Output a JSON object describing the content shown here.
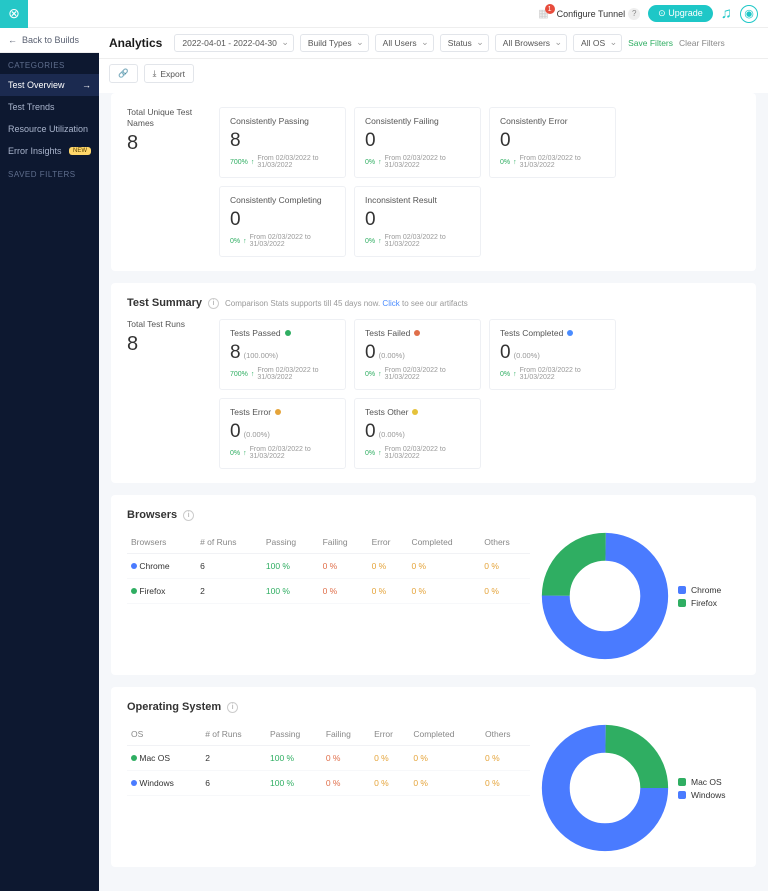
{
  "header": {
    "notif_badge": "1",
    "configure_tunnel": "Configure Tunnel",
    "upgrade": "⊙ Upgrade"
  },
  "sidebar": {
    "back": "Back to Builds",
    "h1": "CATEGORIES",
    "items": [
      "Test Overview",
      "Test Trends",
      "Resource Utilization",
      "Error Insights"
    ],
    "pill": "NEW",
    "h2": "SAVED FILTERS"
  },
  "filters": {
    "title": "Analytics",
    "date": "2022-04-01 - 2022-04-30",
    "f": [
      "Build Types",
      "All Users",
      "Status",
      "All Browsers",
      "All OS"
    ],
    "save": "Save Filters",
    "clear": "Clear Filters",
    "export": "Export"
  },
  "overview": {
    "left_t": "Total Unique Test Names",
    "left_n": "8",
    "tiles": [
      {
        "t": "Consistently Passing",
        "n": "8",
        "pct": "700%",
        "range": "From 02/03/2022 to 31/03/2022"
      },
      {
        "t": "Consistently Failing",
        "n": "0",
        "pct": "0%",
        "range": "From 02/03/2022 to 31/03/2022"
      },
      {
        "t": "Consistently Error",
        "n": "0",
        "pct": "0%",
        "range": "From 02/03/2022 to 31/03/2022"
      },
      {
        "t": "Consistently Completing",
        "n": "0",
        "pct": "0%",
        "range": "From 02/03/2022 to 31/03/2022"
      },
      {
        "t": "Inconsistent Result",
        "n": "0",
        "pct": "0%",
        "range": "From 02/03/2022 to 31/03/2022"
      }
    ]
  },
  "summary": {
    "h": "Test Summary",
    "sub": "Comparison Stats supports till 45 days now. ",
    "sub_link": "Click",
    "sub2": " to see our artifacts",
    "left_t": "Total Test Runs",
    "left_n": "8",
    "tiles": [
      {
        "t": "Tests Passed",
        "dot": "#2fae62",
        "n": "8",
        "sub": "(100.00%)",
        "pct": "700%",
        "range": "From 02/03/2022 to 31/03/2022"
      },
      {
        "t": "Tests Failed",
        "dot": "#e06f4a",
        "n": "0",
        "sub": "(0.00%)",
        "pct": "0%",
        "range": "From 02/03/2022 to 31/03/2022"
      },
      {
        "t": "Tests Completed",
        "dot": "#4a8cff",
        "n": "0",
        "sub": "(0.00%)",
        "pct": "0%",
        "range": "From 02/03/2022 to 31/03/2022"
      },
      {
        "t": "Tests Error",
        "dot": "#e5a43a",
        "n": "0",
        "sub": "(0.00%)",
        "pct": "0%",
        "range": "From 02/03/2022 to 31/03/2022"
      },
      {
        "t": "Tests Other",
        "dot": "#e5c23a",
        "n": "0",
        "sub": "(0.00%)",
        "pct": "0%",
        "range": "From 02/03/2022 to 31/03/2022"
      }
    ]
  },
  "browsers": {
    "h": "Browsers",
    "cols": [
      "Browsers",
      "# of Runs",
      "Passing",
      "Failing",
      "Error",
      "Completed",
      "Others"
    ],
    "rows": [
      {
        "dot": "#4a7bff",
        "name": "Chrome",
        "runs": "6",
        "p": "100 %",
        "f": "0 %",
        "e": "0 %",
        "c": "0 %",
        "o": "0 %"
      },
      {
        "dot": "#2fae62",
        "name": "Firefox",
        "runs": "2",
        "p": "100 %",
        "f": "0 %",
        "e": "0 %",
        "c": "0 %",
        "o": "0 %"
      }
    ],
    "legend": [
      {
        "c": "#4a7bff",
        "t": "Chrome"
      },
      {
        "c": "#2fae62",
        "t": "Firefox"
      }
    ]
  },
  "os": {
    "h": "Operating System",
    "cols": [
      "OS",
      "# of Runs",
      "Passing",
      "Failing",
      "Error",
      "Completed",
      "Others"
    ],
    "rows": [
      {
        "dot": "#2fae62",
        "name": "Mac OS",
        "runs": "2",
        "p": "100 %",
        "f": "0 %",
        "e": "0 %",
        "c": "0 %",
        "o": "0 %"
      },
      {
        "dot": "#4a7bff",
        "name": "Windows",
        "runs": "6",
        "p": "100 %",
        "f": "0 %",
        "e": "0 %",
        "c": "0 %",
        "o": "0 %"
      }
    ],
    "legend": [
      {
        "c": "#2fae62",
        "t": "Mac OS"
      },
      {
        "c": "#4a7bff",
        "t": "Windows"
      }
    ]
  },
  "chart_data": [
    {
      "type": "pie",
      "title": "Browsers",
      "series": [
        {
          "name": "Chrome",
          "value": 6,
          "color": "#4a7bff"
        },
        {
          "name": "Firefox",
          "value": 2,
          "color": "#2fae62"
        }
      ]
    },
    {
      "type": "pie",
      "title": "Operating System",
      "series": [
        {
          "name": "Mac OS",
          "value": 2,
          "color": "#2fae62"
        },
        {
          "name": "Windows",
          "value": 6,
          "color": "#4a7bff"
        }
      ]
    }
  ]
}
